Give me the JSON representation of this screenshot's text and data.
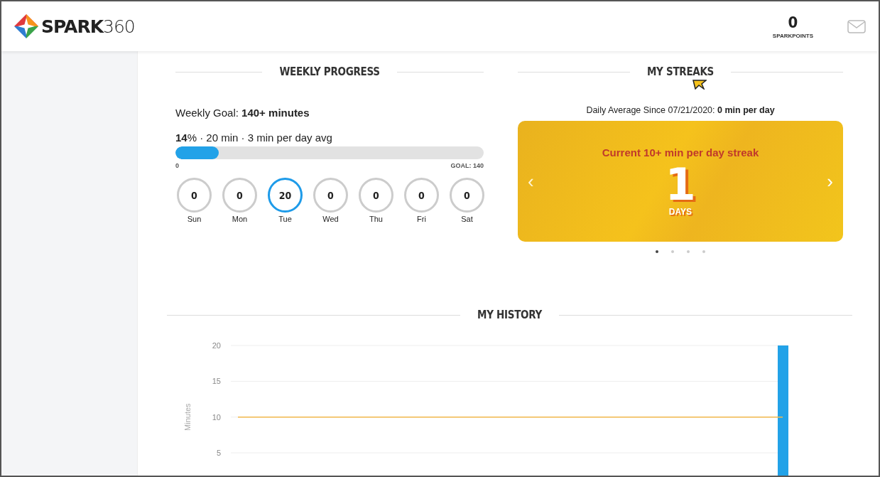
{
  "header": {
    "logo": "**SPARK**360",
    "points": "0",
    "points_label": "SPARKPOINTS"
  },
  "weekly_progress": {
    "title": "WEEKLY PROGRESS",
    "goal": "Weekly Goal: **140+ minutes**",
    "summary": "**14**% · 20 min · 3 min per day avg",
    "level": 0.14,
    "min_label": "0",
    "max_label": "GOAL: 140",
    "days": [
      {
        "value": "0",
        "label": "Sun",
        "selected": false
      },
      {
        "value": "0",
        "label": "Mon",
        "selected": false
      },
      {
        "value": "20",
        "label": "Tue",
        "selected": true
      },
      {
        "value": "0",
        "label": "Wed",
        "selected": false
      },
      {
        "value": "0",
        "label": "Thu",
        "selected": false
      },
      {
        "value": "0",
        "label": "Fri",
        "selected": false
      },
      {
        "value": "0",
        "label": "Sat",
        "selected": false
      }
    ]
  },
  "streaks": {
    "title": "MY STREAKS",
    "average": "Daily Average Since 07/21/2020: **0 min per day**",
    "card": {
      "title": "Current 10+ min per day streak",
      "number": "1",
      "unit": "DAYS",
      "prev": "‹",
      "next": "›"
    },
    "dots": [
      {
        "selected": true
      },
      {
        "selected": false
      },
      {
        "selected": false
      },
      {
        "selected": false
      }
    ]
  },
  "history": {
    "title": "MY HISTORY",
    "chart_data": {
      "type": "bar",
      "ylabel": "Minutes",
      "yticks": [
        5,
        10,
        15,
        20
      ],
      "ylim": [
        0,
        20
      ],
      "grid": true,
      "series": [
        {
          "color": "#22a2e8",
          "values": [
            0,
            0,
            0,
            0,
            0,
            0,
            0,
            0,
            0,
            0,
            0,
            0,
            0,
            0,
            0,
            0,
            0,
            0,
            0,
            0,
            0,
            0,
            0,
            20
          ]
        }
      ],
      "ref_lines": [
        {
          "axis": "y",
          "value": 10,
          "color": "#f2b84b"
        }
      ]
    }
  }
}
